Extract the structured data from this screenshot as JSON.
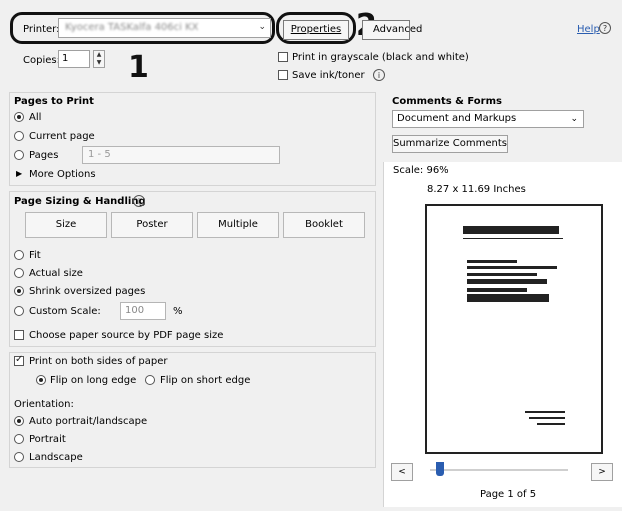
{
  "top": {
    "printer_label": "Printer:",
    "printer_value": "Kyocera TASKalfa 406ci KX",
    "properties_label": "Properties",
    "advanced_label": "Advanced",
    "help_label": "Help",
    "copies_label": "Copies:",
    "copies_value": "1",
    "grayscale_label": "Print in grayscale (black and white)",
    "save_ink_label": "Save ink/toner",
    "callout_1": "1",
    "callout_2": "2"
  },
  "pages_to_print": {
    "title": "Pages to Print",
    "all": "All",
    "current": "Current page",
    "pages": "Pages",
    "pages_value": "1 - 5",
    "more_options": "More Options"
  },
  "sizing": {
    "title": "Page Sizing & Handling",
    "buttons": [
      "Size",
      "Poster",
      "Multiple",
      "Booklet"
    ],
    "fit": "Fit",
    "actual": "Actual size",
    "shrink": "Shrink oversized pages",
    "custom": "Custom Scale:",
    "custom_value": "100",
    "percent": "%",
    "paper_source": "Choose paper source by PDF page size"
  },
  "duplex": {
    "both_sides": "Print on both sides of paper",
    "long_edge": "Flip on long edge",
    "short_edge": "Flip on short edge"
  },
  "orientation": {
    "title": "Orientation:",
    "auto": "Auto portrait/landscape",
    "portrait": "Portrait",
    "landscape": "Landscape"
  },
  "comments": {
    "title": "Comments & Forms",
    "selected": "Document and Markups",
    "summarize": "Summarize Comments"
  },
  "preview": {
    "scale": "Scale: 96%",
    "dimensions": "8.27 x 11.69 Inches",
    "page_indicator": "Page 1 of 5",
    "prev": "<",
    "next": ">"
  }
}
